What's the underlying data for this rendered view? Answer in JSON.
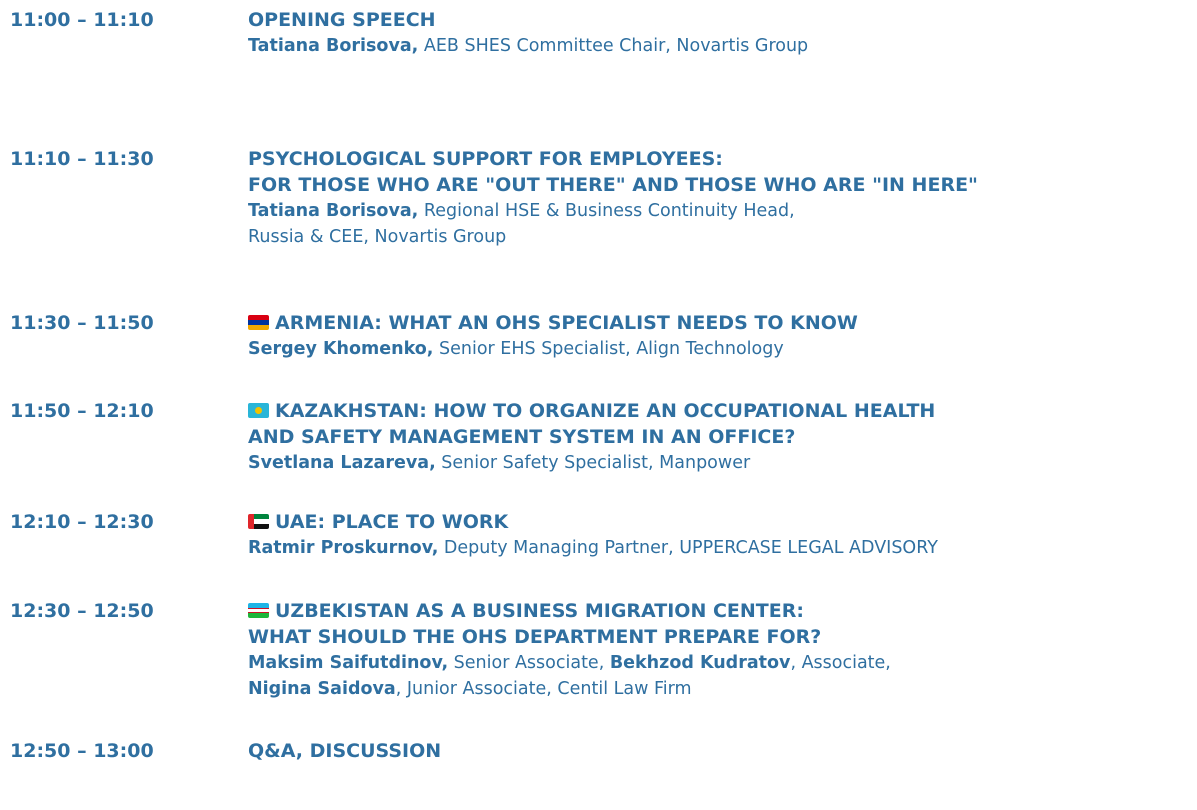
{
  "sessions": [
    {
      "time": "11:00 – 11:10",
      "title_lines": [
        "OPENING SPEECH"
      ],
      "speaker_lines": [
        [
          {
            "text": "Tatiana Borisova,",
            "bold": true
          },
          {
            "text": " AEB SHES Committee Chair, Novartis Group",
            "bold": false
          }
        ]
      ]
    },
    {
      "time": "11:10 – 11:30",
      "title_lines": [
        "PSYCHOLOGICAL SUPPORT FOR EMPLOYEES:",
        "FOR THOSE WHO ARE \"OUT THERE\" AND THOSE WHO ARE \"IN HERE\""
      ],
      "speaker_lines": [
        [
          {
            "text": "Tatiana Borisova,",
            "bold": true
          },
          {
            "text": " Regional HSE & Business Continuity Head,",
            "bold": false
          }
        ],
        [
          {
            "text": "Russia & CEE, Novartis Group",
            "bold": false
          }
        ]
      ]
    },
    {
      "time": "11:30 – 11:50",
      "flag": "armenia-flag-icon",
      "title_lines": [
        "ARMENIA: WHAT AN OHS SPECIALIST NEEDS TO KNOW"
      ],
      "speaker_lines": [
        [
          {
            "text": "Sergey Khomenko,",
            "bold": true
          },
          {
            "text": " Senior EHS Specialist, Align Technology",
            "bold": false
          }
        ]
      ]
    },
    {
      "time": "11:50 – 12:10",
      "flag": "kazakhstan-flag-icon",
      "title_lines": [
        "KAZAKHSTAN: HOW TO ORGANIZE AN OCCUPATIONAL HEALTH",
        "AND SAFETY MANAGEMENT SYSTEM IN AN OFFICE?"
      ],
      "speaker_lines": [
        [
          {
            "text": "Svetlana Lazareva,",
            "bold": true
          },
          {
            "text": " Senior Safety Specialist, Manpower",
            "bold": false
          }
        ]
      ]
    },
    {
      "time": "12:10 – 12:30",
      "flag": "uae-flag-icon",
      "title_lines": [
        "UAE: PLACE TO WORK"
      ],
      "speaker_lines": [
        [
          {
            "text": "Ratmir Proskurnov,",
            "bold": true
          },
          {
            "text": " Deputy Managing Partner, UPPERCASE LEGAL ADVISORY",
            "bold": false
          }
        ]
      ]
    },
    {
      "time": "12:30 – 12:50",
      "flag": "uzbekistan-flag-icon",
      "title_lines": [
        "UZBEKISTAN AS A BUSINESS MIGRATION CENTER:",
        "WHAT SHOULD THE OHS DEPARTMENT PREPARE FOR?"
      ],
      "speaker_lines": [
        [
          {
            "text": "Maksim Saifutdinov,",
            "bold": true
          },
          {
            "text": " Senior Associate, ",
            "bold": false
          },
          {
            "text": "Bekhzod Kudratov",
            "bold": true
          },
          {
            "text": ", Associate,",
            "bold": false
          }
        ],
        [
          {
            "text": "Nigina Saidova",
            "bold": true
          },
          {
            "text": ", Junior Associate, Centil Law Firm",
            "bold": false
          }
        ]
      ]
    },
    {
      "time": "12:50 – 13:00",
      "title_lines": [
        "Q&A, DISCUSSION"
      ],
      "speaker_lines": []
    }
  ],
  "colors": {
    "text": "#2f6fa0"
  }
}
